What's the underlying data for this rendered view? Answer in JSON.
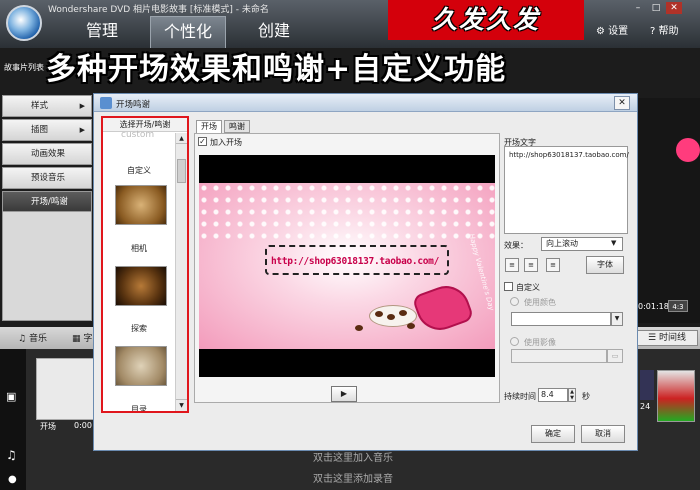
{
  "app": {
    "title": "Wondershare DVD 相片电影故事 [标准模式] - 未命名",
    "tabs": [
      "管理",
      "个性化",
      "创建"
    ],
    "settings_label": "设置",
    "help_label": "帮助",
    "window_controls": [
      "–",
      "□",
      "✕"
    ]
  },
  "promo": {
    "top_banner": "久发久发",
    "headline": "多种开场效果和鸣谢+自定义功能"
  },
  "background": {
    "story_label": "故事片列表",
    "left_menu": [
      {
        "label": "样式",
        "arrow": "▶"
      },
      {
        "label": "插图",
        "arrow": "▶"
      },
      {
        "label": "动画效果",
        "arrow": ""
      },
      {
        "label": "预设音乐",
        "arrow": ""
      },
      {
        "label": "开场/鸣谢",
        "arrow": ""
      }
    ],
    "time_readout": "0:01:18",
    "ratio_badge": "4:3",
    "timeline": {
      "music_label": "音乐",
      "text_label": "字",
      "timeline_button": "时间线",
      "clip_label": "开场",
      "clip_time": "0:00",
      "clip_number": "24",
      "hint_music": "双击这里加入音乐",
      "hint_record": "双击这里添加录音"
    }
  },
  "dialog": {
    "title": "开场鸣谢",
    "close": "✕",
    "list": {
      "header": "选择开场/鸣谢",
      "ghost_text": "custom",
      "items": [
        "自定义",
        "相机",
        "探索",
        "目录"
      ]
    },
    "sub_tabs": [
      "开场",
      "鸣谢"
    ],
    "add_opening": {
      "checked": "✓",
      "label": "加入开场"
    },
    "preview": {
      "url_text": "http://shop63018137.taobao.com/",
      "script_text": "Happy Valentine's Day"
    },
    "play_symbol": "▶",
    "opening_text": {
      "legend": "开场文字",
      "value": "http://shop63018137.taobao.com/"
    },
    "effect": {
      "label": "效果：",
      "value": "向上滚动"
    },
    "align_buttons": [
      "≡",
      "≡",
      "≡"
    ],
    "font_button": "字体",
    "custom": {
      "label": "自定义",
      "use_color": "使用颜色",
      "use_image": "使用影像"
    },
    "duration": {
      "label": "持续时间",
      "value": "8.4",
      "unit": "秒"
    },
    "ok_button": "确定",
    "cancel_button": "取消"
  }
}
